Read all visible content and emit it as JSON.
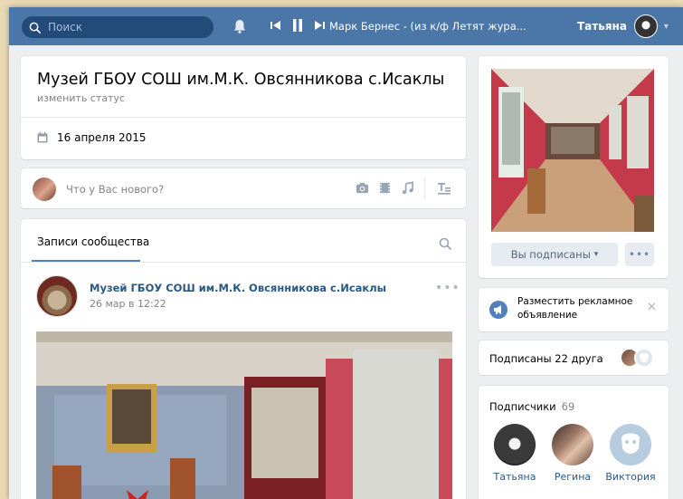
{
  "header": {
    "search_placeholder": "Поиск",
    "track": "Марк Бернес - (из к/ф Летят жура...",
    "user_name": "Татьяна",
    "brand_color": "#4a76a8"
  },
  "profile": {
    "title": "Музей ГБОУ СОШ им.М.К. Овсянникова с.Исаклы",
    "status": "изменить статус",
    "date": "16 апреля 2015"
  },
  "compose": {
    "placeholder": "Что у Вас нового?"
  },
  "feed": {
    "tab": "Записи сообщества",
    "post": {
      "author": "Музей ГБОУ СОШ им.М.К. Овсянникова с.Исаклы",
      "time": "26 мар в 12:22",
      "more": "•••"
    }
  },
  "side": {
    "subscribed_label": "Вы подписаны",
    "more": "•••",
    "ad_text": "Разместить рекламное объявление",
    "friends_text": "Подписаны 22 друга",
    "subscribers_title": "Подписчики",
    "subscribers_count": "69",
    "subscribers": [
      {
        "name": "Татьяна"
      },
      {
        "name": "Регина"
      },
      {
        "name": "Виктория"
      }
    ]
  }
}
